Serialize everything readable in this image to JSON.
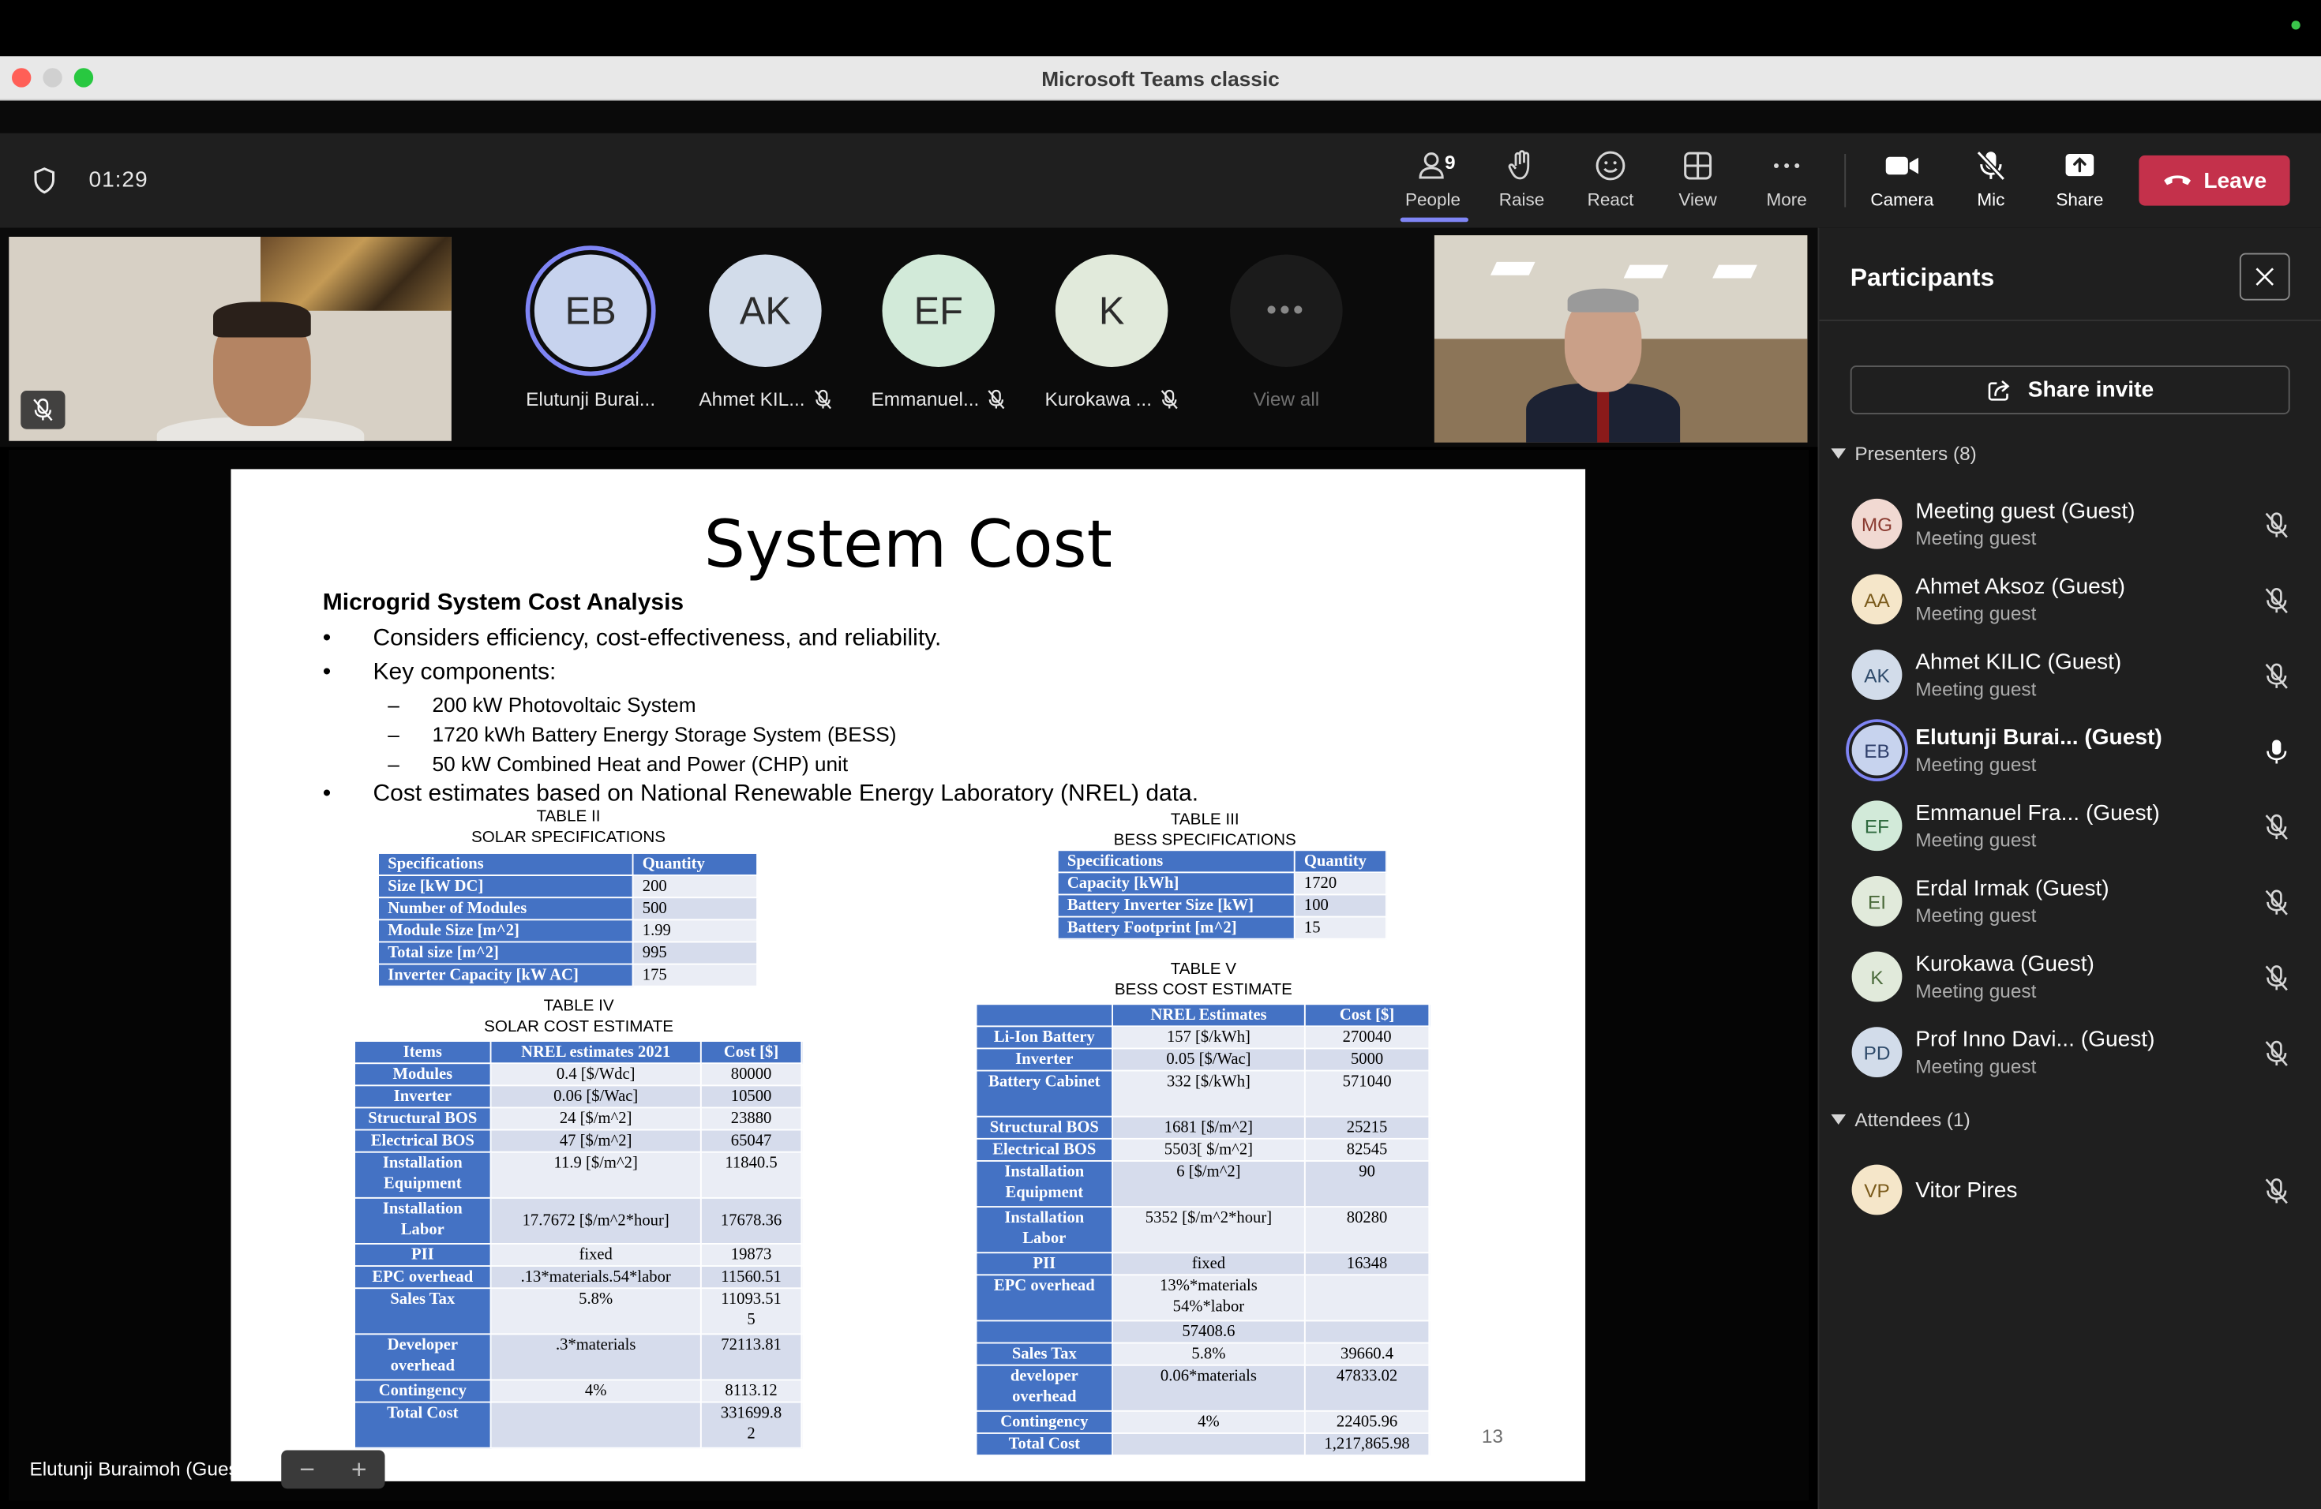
{
  "window": {
    "title": "Microsoft Teams classic"
  },
  "toolbar": {
    "timer": "01:29",
    "people_count": "9",
    "people_label": "People",
    "raise_label": "Raise",
    "react_label": "React",
    "view_label": "View",
    "more_label": "More",
    "camera_label": "Camera",
    "mic_label": "Mic",
    "share_label": "Share",
    "leave_label": "Leave"
  },
  "gallery": {
    "tiles": [
      {
        "initials": "EB",
        "name": "Elutunji Burai...",
        "color": "#c7d3ee"
      },
      {
        "initials": "AK",
        "name": "Ahmet KIL...",
        "color": "#d2dcea"
      },
      {
        "initials": "EF",
        "name": "Emmanuel...",
        "color": "#d2ead9"
      },
      {
        "initials": "K",
        "name": "Kurokawa ...",
        "color": "#e1eadb"
      }
    ],
    "view_all_label": "View all"
  },
  "slide": {
    "title": "System Cost",
    "subtitle": "Microgrid System Cost Analysis",
    "bullet1": "Considers efficiency, cost-effectiveness, and reliability.",
    "bullet2": "Key components:",
    "sub1": "200 kW Photovoltaic System",
    "sub2": "1720 kWh Battery Energy Storage System (BESS)",
    "sub3": "50 kW Combined Heat and Power (CHP) unit",
    "bullet3": "Cost estimates based on National Renewable Energy Laboratory (NREL) data.",
    "page_number": "13",
    "table2": {
      "caption1": "TABLE II",
      "caption2": "SOLAR SPECIFICATIONS",
      "headers": [
        "Specifications",
        "Quantity"
      ],
      "rows": [
        [
          "Size [kW DC]",
          "200"
        ],
        [
          "Number of Modules",
          "500"
        ],
        [
          "Module Size [m^2]",
          "1.99"
        ],
        [
          "Total size [m^2]",
          "995"
        ],
        [
          "Inverter Capacity [kW AC]",
          "175"
        ]
      ]
    },
    "table3": {
      "caption1": "TABLE III",
      "caption2": "BESS SPECIFICATIONS",
      "headers": [
        "Specifications",
        "Quantity"
      ],
      "rows": [
        [
          "Capacity [kWh]",
          "1720"
        ],
        [
          "Battery Inverter Size [kW]",
          "100"
        ],
        [
          "Battery Footprint [m^2]",
          "15"
        ]
      ]
    },
    "table4": {
      "caption1": "TABLE IV",
      "caption2": "SOLAR COST ESTIMATE",
      "headers": [
        "Items",
        "NREL estimates 2021",
        "Cost [$]"
      ],
      "rows": [
        [
          "Modules",
          "0.4 [$/Wdc]",
          "80000"
        ],
        [
          "Inverter",
          "0.06 [$/Wac]",
          "10500"
        ],
        [
          "Structural BOS",
          "24 [$/m^2]",
          "23880"
        ],
        [
          "Electrical BOS",
          "47 [$/m^2]",
          "65047"
        ],
        [
          "Installation Equipment",
          "11.9 [$/m^2]",
          "11840.5"
        ],
        [
          "Installation Labor",
          "17.7672 [$/m^2*hour]",
          "17678.36"
        ],
        [
          "PII",
          "fixed",
          "19873"
        ],
        [
          "EPC overhead",
          ".13*materials.54*labor",
          "11560.51"
        ],
        [
          "Sales Tax",
          "5.8%",
          "11093.51 5"
        ],
        [
          "Developer overhead",
          ".3*materials",
          "72113.81"
        ],
        [
          "Contingency",
          "4%",
          "8113.12"
        ],
        [
          "Total Cost",
          "",
          "331699.8 2"
        ]
      ]
    },
    "table5": {
      "caption1": "TABLE V",
      "caption2": "BESS COST ESTIMATE",
      "headers": [
        "",
        "NREL Estimates",
        "Cost [$]"
      ],
      "rows": [
        [
          "Li-Ion Battery",
          "157 [$/kWh]",
          "270040"
        ],
        [
          "Inverter",
          "0.05 [$/Wac]",
          "5000"
        ],
        [
          "Battery Cabinet",
          "332 [$/kWh]",
          "571040"
        ],
        [
          "Structural BOS",
          "1681 [$/m^2]",
          "25215"
        ],
        [
          "Electrical BOS",
          "5503[ $/m^2]",
          "82545"
        ],
        [
          "Installation Equipment",
          "6 [$/m^2]",
          "90"
        ],
        [
          "Installation Labor",
          "5352 [$/m^2*hour]",
          "80280"
        ],
        [
          "PII",
          "fixed",
          "16348"
        ],
        [
          "EPC overhead",
          "13%*materials 54%*labor",
          ""
        ],
        [
          "",
          "57408.6",
          ""
        ],
        [
          "Sales Tax",
          "5.8%",
          "39660.4"
        ],
        [
          "developer overhead",
          "0.06*materials",
          "47833.02"
        ],
        [
          "Contingency",
          "4%",
          "22405.96"
        ],
        [
          "Total Cost",
          "",
          "1,217,865.98"
        ]
      ]
    }
  },
  "stage": {
    "speaker_label": "Elutunji Buraimoh (Guest)",
    "zoom_out": "−",
    "zoom_in": "+"
  },
  "panel": {
    "title": "Participants",
    "share_invite": "Share invite",
    "presenters_header": "Presenters (8)",
    "attendees_header": "Attendees (1)",
    "presenters": [
      {
        "initials": "MG",
        "name": "Meeting guest (Guest)",
        "role": "Meeting guest",
        "color": "#f1d9d2"
      },
      {
        "initials": "AA",
        "name": "Ahmet Aksoz (Guest)",
        "role": "Meeting guest",
        "color": "#f5e6c9"
      },
      {
        "initials": "AK",
        "name": "Ahmet KILIC (Guest)",
        "role": "Meeting guest",
        "color": "#d2dcea"
      },
      {
        "initials": "EB",
        "name": "Elutunji Burai...  (Guest)",
        "role": "Meeting guest",
        "color": "#c7d3ee"
      },
      {
        "initials": "EF",
        "name": "Emmanuel Fra...  (Guest)",
        "role": "Meeting guest",
        "color": "#d2ead9"
      },
      {
        "initials": "EI",
        "name": "Erdal Irmak (Guest)",
        "role": "Meeting guest",
        "color": "#e1eadb"
      },
      {
        "initials": "K",
        "name": "Kurokawa (Guest)",
        "role": "Meeting guest",
        "color": "#e1eadb"
      },
      {
        "initials": "PD",
        "name": "Prof Inno Davi...  (Guest)",
        "role": "Meeting guest",
        "color": "#d2dcea"
      }
    ],
    "attendees": [
      {
        "initials": "VP",
        "name": "Vitor Pires",
        "color": "#f5e6c9"
      }
    ]
  }
}
